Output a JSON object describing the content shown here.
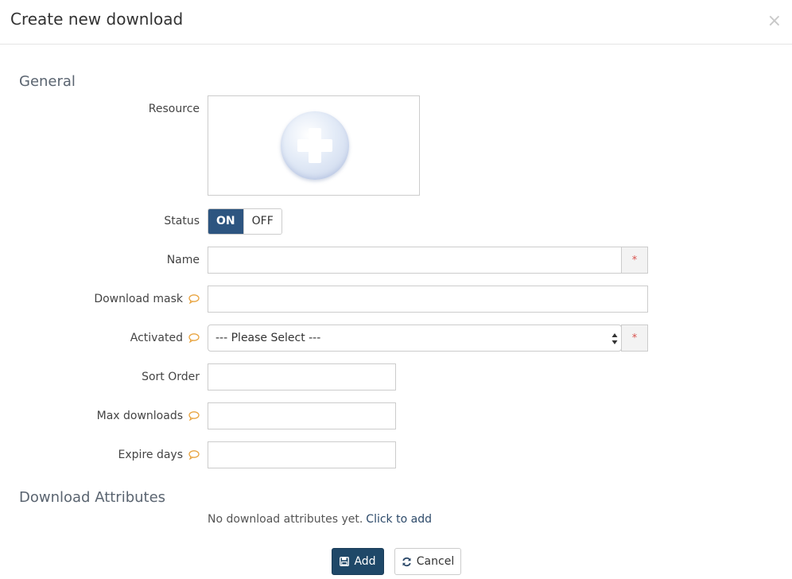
{
  "modal": {
    "title": "Create new download",
    "close_symbol": "×"
  },
  "sections": {
    "general": "General",
    "attributes": "Download Attributes"
  },
  "form": {
    "resource_label": "Resource",
    "status": {
      "label": "Status",
      "on_label": "ON",
      "off_label": "OFF",
      "selected": "ON"
    },
    "name": {
      "label": "Name",
      "value": "",
      "required_marker": "*"
    },
    "download_mask": {
      "label": "Download mask",
      "value": ""
    },
    "activated": {
      "label": "Activated",
      "selected": "--- Please Select ---",
      "required_marker": "*"
    },
    "sort_order": {
      "label": "Sort Order",
      "value": ""
    },
    "max_downloads": {
      "label": "Max downloads",
      "value": ""
    },
    "expire_days": {
      "label": "Expire days",
      "value": ""
    }
  },
  "attributes": {
    "empty_text": "No download attributes yet.",
    "add_link": "Click to add"
  },
  "buttons": {
    "add_label": "Add",
    "cancel_label": "Cancel"
  },
  "icons": {
    "hint": "comment-icon",
    "add": "floppy-disk-icon",
    "cancel": "refresh-icon",
    "resource": "plus-circle-icon"
  },
  "colors": {
    "primary": "#2d5580",
    "add_button": "#1f4868",
    "hint_icon": "#e8a23c",
    "required": "#d9534f"
  }
}
